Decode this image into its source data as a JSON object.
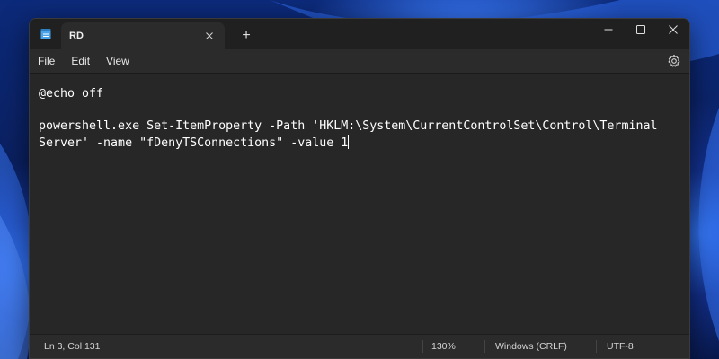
{
  "window": {
    "tab_title": "RD",
    "new_tab_symbol": "+"
  },
  "menu": {
    "items": [
      "File",
      "Edit",
      "View"
    ]
  },
  "editor": {
    "lines": [
      "@echo off",
      "",
      "powershell.exe Set-ItemProperty -Path 'HKLM:\\System\\CurrentControlSet\\Control\\Terminal",
      "Server' -name \"fDenyTSConnections\" -value 1"
    ]
  },
  "status": {
    "position": "Ln 3, Col 131",
    "zoom": "130%",
    "line_ending": "Windows (CRLF)",
    "encoding": "UTF-8"
  },
  "icons": {
    "app": "notepad-icon",
    "tab_close": "close-icon",
    "new_tab": "plus-icon",
    "minimize": "minimize-icon",
    "maximize": "maximize-icon",
    "close": "close-icon",
    "settings": "gear-icon"
  },
  "colors": {
    "window_bg": "#202020",
    "editor_bg": "#272727",
    "text": "#ffffff",
    "accent": "#3a7cff"
  }
}
